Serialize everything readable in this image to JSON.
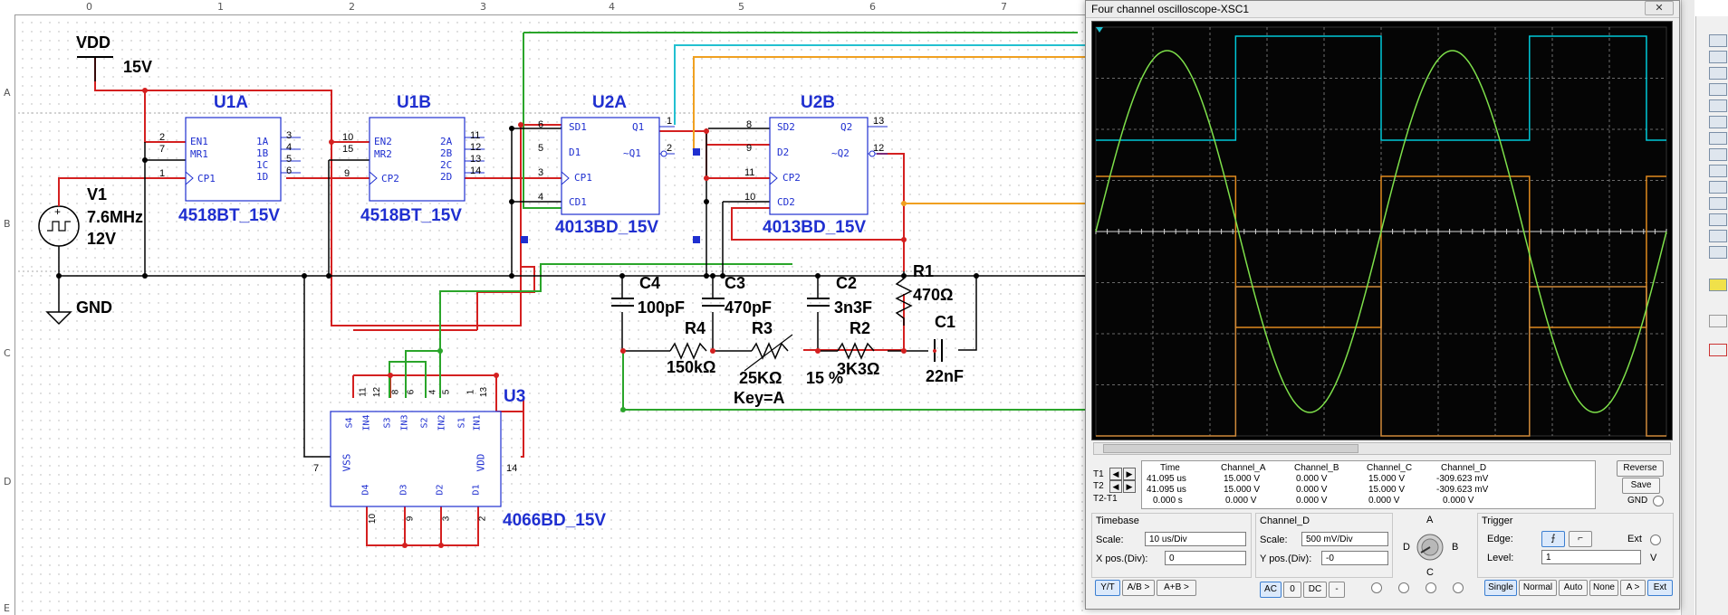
{
  "ruler": {
    "columns": [
      "0",
      "1",
      "2",
      "3",
      "4",
      "5",
      "6",
      "7"
    ],
    "rows": [
      "A",
      "B",
      "C",
      "D",
      "E"
    ]
  },
  "schematic": {
    "vdd_label": "VDD",
    "vdd_value": "15V",
    "gnd_label": "GND",
    "v1_name": "V1",
    "v1_freq": "7.6MHz",
    "v1_amp": "12V",
    "u1a": {
      "name": "U1A",
      "part": "4518BT_15V",
      "pins_left": [
        "EN1",
        "MR1",
        "CP1"
      ],
      "pins_right": [
        "1A",
        "1B",
        "1C",
        "1D"
      ],
      "num_left": [
        "2",
        "7",
        "1"
      ],
      "num_right": [
        "3",
        "4",
        "5",
        "6"
      ]
    },
    "u1b": {
      "name": "U1B",
      "part": "4518BT_15V",
      "pins_left": [
        "EN2",
        "MR2",
        "CP2"
      ],
      "pins_right": [
        "2A",
        "2B",
        "2C",
        "2D"
      ],
      "num_left": [
        "10",
        "15",
        "9"
      ],
      "num_right": [
        "11",
        "12",
        "13",
        "14"
      ]
    },
    "u2a": {
      "name": "U2A",
      "part": "4013BD_15V",
      "pins_left": [
        "SD1",
        "D1",
        "CP1",
        "CD1"
      ],
      "pins_right": [
        "Q1",
        "~Q1"
      ],
      "num_left": [
        "6",
        "5",
        "3",
        "4"
      ],
      "num_right": [
        "1",
        "2"
      ]
    },
    "u2b": {
      "name": "U2B",
      "part": "4013BD_15V",
      "pins_left": [
        "SD2",
        "D2",
        "CP2",
        "CD2"
      ],
      "pins_right": [
        "Q2",
        "~Q2"
      ],
      "num_left": [
        "8",
        "9",
        "11",
        "10"
      ],
      "num_right": [
        "13",
        "12"
      ]
    },
    "u3": {
      "name": "U3",
      "part": "4066BD_15V",
      "top_pins": [
        "S4",
        "IN4",
        "S3",
        "IN3",
        "S2",
        "IN2",
        "S1",
        "IN1"
      ],
      "top_nums": [
        "11",
        "12",
        "8",
        "6",
        "4",
        "5",
        "1",
        "13"
      ],
      "bottom_pins": [
        "D4",
        "D3",
        "D2",
        "D1"
      ],
      "bottom_nums": [
        "10",
        "9",
        "3",
        "2"
      ],
      "vss": "VSS",
      "vss_num": "7",
      "vdd": "VDD",
      "vdd_num": "14"
    },
    "c4": {
      "name": "C4",
      "value": "100pF"
    },
    "c3": {
      "name": "C3",
      "value": "470pF"
    },
    "c2": {
      "name": "C2",
      "value": "3n3F"
    },
    "r1": {
      "name": "R1",
      "value": "470Ω"
    },
    "c1": {
      "name": "C1",
      "value": "22nF"
    },
    "r4": {
      "name": "R4",
      "value": "150kΩ"
    },
    "r3": {
      "name": "R3",
      "value": "25KΩ",
      "key": "Key=A",
      "percent": "15 %"
    },
    "r2": {
      "name": "R2",
      "value": "3K3Ω"
    }
  },
  "oscilloscope": {
    "title": "Four channel oscilloscope-XSC1",
    "close": "✕",
    "readout": {
      "rows": [
        "T1",
        "T2",
        "T2-T1"
      ],
      "headers": [
        "Time",
        "Channel_A",
        "Channel_B",
        "Channel_C",
        "Channel_D"
      ],
      "t1": [
        "41.095 us",
        "15.000 V",
        "0.000 V",
        "15.000 V",
        "-309.623 mV"
      ],
      "t2": [
        "41.095 us",
        "15.000 V",
        "0.000 V",
        "15.000 V",
        "-309.623 mV"
      ],
      "dt": [
        "0.000 s",
        "0.000 V",
        "0.000 V",
        "0.000 V",
        "0.000 V"
      ]
    },
    "reverse": "Reverse",
    "save": "Save",
    "gnd": "GND",
    "timebase": {
      "title": "Timebase",
      "scale_label": "Scale:",
      "scale": "10 us/Div",
      "xpos_label": "X pos.(Div):",
      "xpos": "0"
    },
    "channel": {
      "title": "Channel_D",
      "scale_label": "Scale:",
      "scale": "500 mV/Div",
      "ypos_label": "Y pos.(Div):",
      "ypos": "-0"
    },
    "knob": {
      "a": "A",
      "b": "B",
      "c": "C",
      "d": "D"
    },
    "trigger": {
      "title": "Trigger",
      "edge_label": "Edge:",
      "ext": "Ext",
      "level_label": "Level:",
      "level": "1",
      "unit": "V"
    },
    "mode_buttons": [
      "Y/T",
      "A/B >",
      "A+B >"
    ],
    "coupling": [
      "AC",
      "0",
      "DC",
      "-"
    ],
    "trigger_buttons": [
      "Single",
      "Normal",
      "Auto",
      "None",
      "A >",
      "Ext"
    ],
    "traces": {
      "channel_a_color": "#00c8d8",
      "channel_c_color": "#e08a1e",
      "channel_c2_color": "#d08a3a",
      "channel_d_color": "#7ee04a"
    }
  },
  "colors": {
    "wire_red": "#d42020",
    "wire_green": "#2aa52a",
    "wire_cyan": "#22c0d0",
    "wire_orange": "#f0a020",
    "wire_black": "#000000",
    "component_blue": "#1f2fd0"
  }
}
